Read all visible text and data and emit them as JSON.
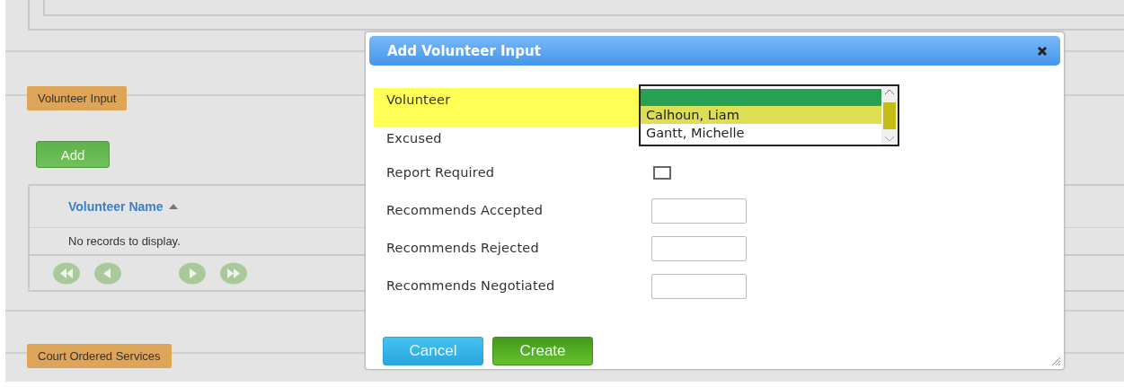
{
  "page": {
    "sections": [
      {
        "title": "Volunteer Input",
        "add_button": "Add",
        "grid": {
          "columns": [
            {
              "label": "Volunteer Name",
              "sorted_ascending": true
            }
          ],
          "empty_message": "No records to display."
        }
      },
      {
        "title": "Court Ordered Services"
      }
    ]
  },
  "dialog": {
    "title": "Add Volunteer Input",
    "fields": [
      {
        "kind": "dropdown",
        "label": "Volunteer",
        "highlighted": true,
        "blank_selected": true,
        "options": [
          {
            "label": "Calhoun, Liam",
            "selected": false,
            "hovered": true
          },
          {
            "label": "Gantt, Michelle",
            "selected": false,
            "hovered": false
          }
        ]
      },
      {
        "kind": "label",
        "label": "Excused",
        "highlighted": false
      },
      {
        "kind": "checkbox",
        "label": "Report Required",
        "highlighted": false,
        "checked": false
      },
      {
        "kind": "text",
        "label": "Recommends Accepted",
        "highlighted": false
      },
      {
        "kind": "text",
        "label": "Recommends Rejected",
        "highlighted": false
      },
      {
        "kind": "text",
        "label": "Recommends Negotiated",
        "highlighted": false
      }
    ],
    "buttons": [
      {
        "label": "Cancel",
        "kind": "secondary"
      },
      {
        "label": "Create",
        "kind": "primary"
      }
    ]
  }
}
